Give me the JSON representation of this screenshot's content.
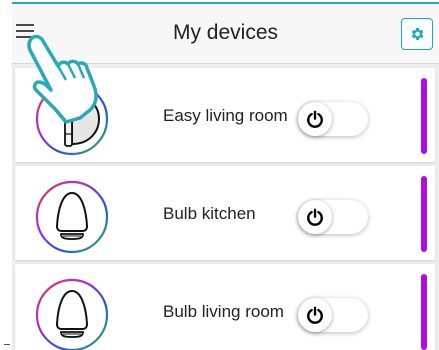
{
  "header": {
    "title": "My devices",
    "menu_icon": "hamburger-menu-icon",
    "settings_icon": "gear-icon"
  },
  "devices": [
    {
      "name": "Easy living room",
      "icon": "half-bulb-icon",
      "power": "on"
    },
    {
      "name": "Bulb kitchen",
      "icon": "bulb-icon",
      "power": "on"
    },
    {
      "name": "Bulb living room",
      "icon": "bulb-icon",
      "power": "on"
    }
  ],
  "overlay": {
    "icon": "pointing-hand-icon"
  },
  "colors": {
    "accent": "#17a9c9",
    "status_bar": "#b00ee0",
    "background": "#eeeeee",
    "card": "#ffffff"
  }
}
